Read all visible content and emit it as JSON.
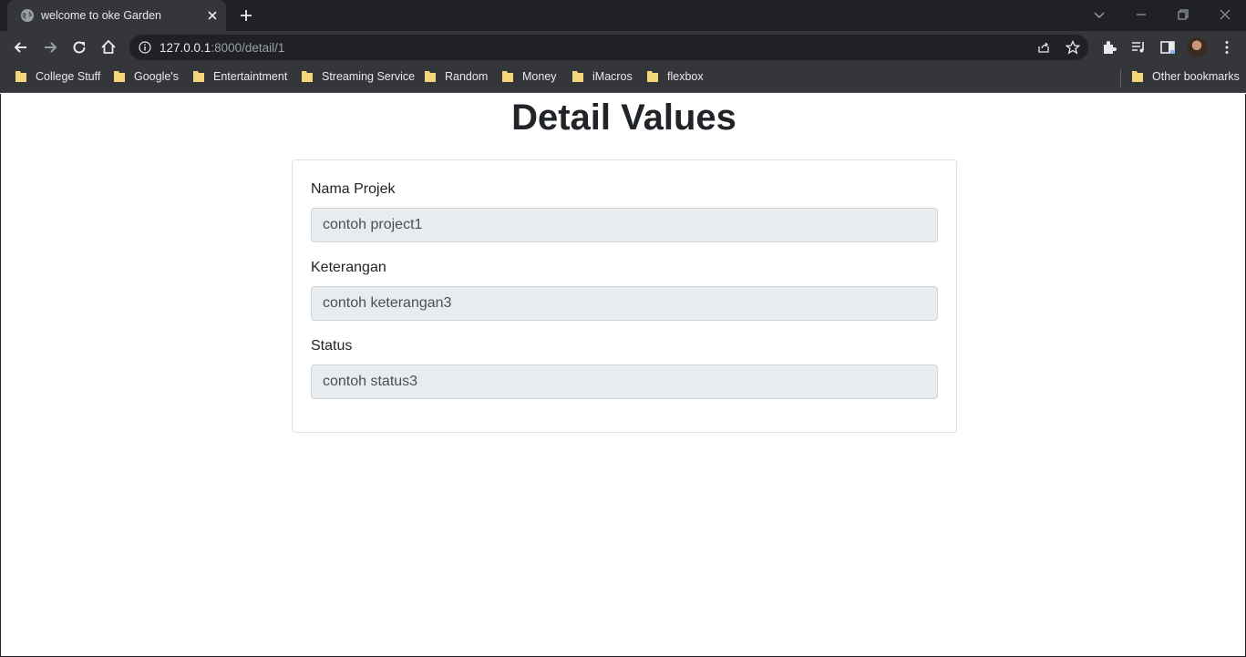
{
  "browser": {
    "tab": {
      "title": "welcome to oke Garden"
    },
    "address": {
      "host": "127.0.0.1",
      "path": ":8000/detail/1"
    },
    "bookmarks": [
      "College Stuff",
      "Google's",
      "Entertaintment",
      "Streaming Service",
      "Random",
      "Money",
      "iMacros",
      "flexbox"
    ],
    "other_bookmarks": "Other bookmarks"
  },
  "page": {
    "title": "Detail Values",
    "fields": [
      {
        "label": "Nama Projek",
        "value": "contoh project1"
      },
      {
        "label": "Keterangan",
        "value": "contoh keterangan3"
      },
      {
        "label": "Status",
        "value": "contoh status3"
      }
    ]
  },
  "colors": {
    "chrome_dark": "#202124",
    "chrome_toolbar": "#35363a",
    "readonly_field": "#e9ecef",
    "text": "#212529",
    "folder": "#f5d67a"
  }
}
